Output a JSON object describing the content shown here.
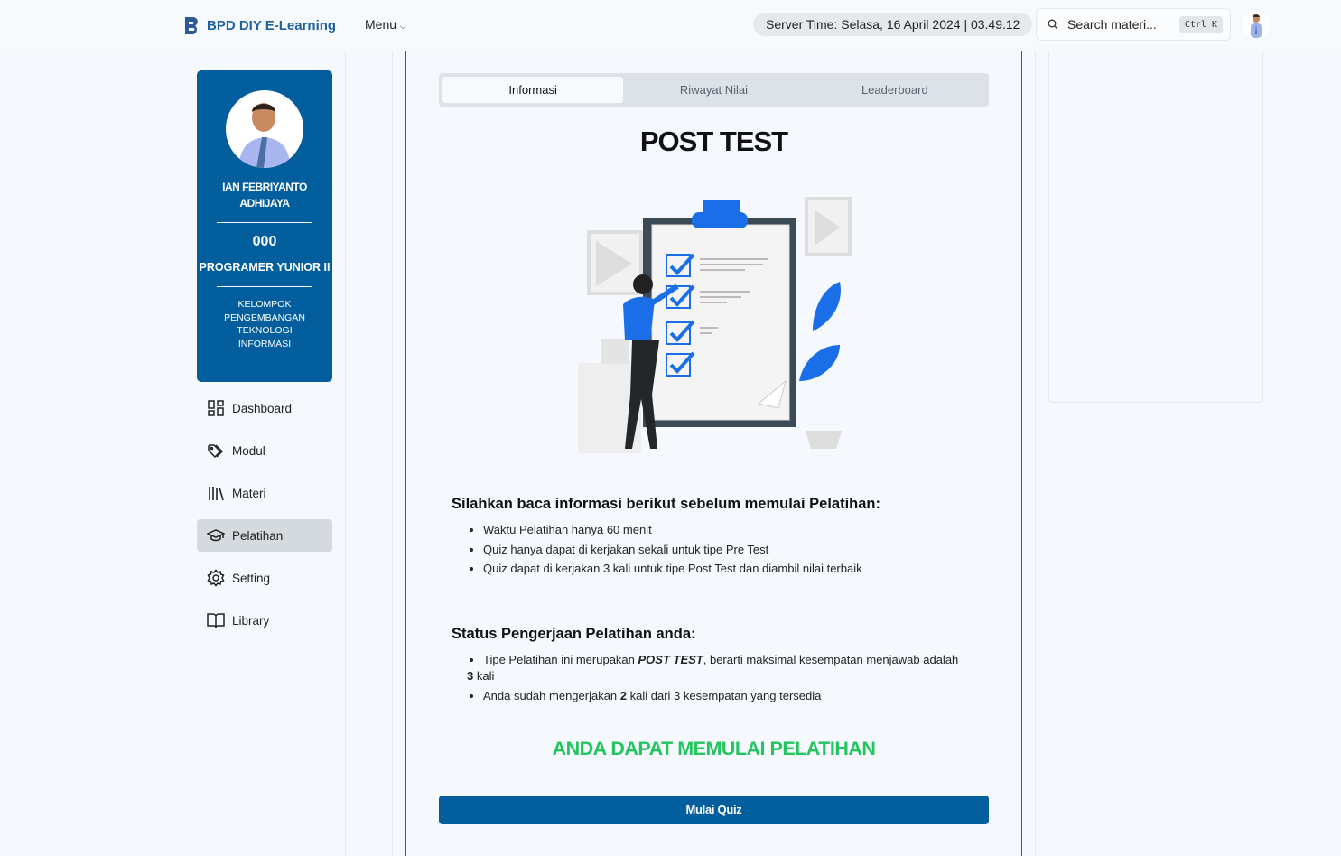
{
  "header": {
    "brand": "BPD DIY E-Learning",
    "menu_label": "Menu",
    "server_time": "Server Time: Selasa, 16 April 2024 | 03.49.12",
    "search_placeholder": "Search materi...",
    "shortcut": "Ctrl K"
  },
  "profile": {
    "name": "IAN FEBRIYANTO ADHIJAYA",
    "number": "000",
    "role": "PROGRAMER YUNIOR II",
    "group": "KELOMPOK PENGEMBANGAN TEKNOLOGI INFORMASI"
  },
  "sidebar": {
    "items": [
      {
        "label": "Dashboard",
        "icon": "dashboard-icon"
      },
      {
        "label": "Modul",
        "icon": "tags-icon"
      },
      {
        "label": "Materi",
        "icon": "library-icon"
      },
      {
        "label": "Pelatihan",
        "icon": "graduation-cap-icon",
        "active": true
      },
      {
        "label": "Setting",
        "icon": "gear-icon"
      },
      {
        "label": "Library",
        "icon": "book-open-icon"
      }
    ]
  },
  "main": {
    "tabs": [
      {
        "label": "Informasi",
        "active": true
      },
      {
        "label": "Riwayat Nilai"
      },
      {
        "label": "Leaderboard"
      }
    ],
    "title": "POST TEST",
    "info_heading": "Silahkan baca informasi berikut sebelum memulai Pelatihan:",
    "info_items": [
      "Waktu Pelatihan hanya 60 menit",
      "Quiz hanya dapat di kerjakan sekali untuk tipe Pre Test",
      "Quiz dapat di kerjakan 3 kali untuk tipe Post Test dan diambil nilai terbaik"
    ],
    "status_heading": "Status Pengerjaan Pelatihan anda:",
    "status_1": {
      "before": "Tipe Pelatihan ini merupakan ",
      "type": "POST TEST",
      "after": ", berarti maksimal kesempatan menjawab adalah ",
      "max": "3",
      "tail": " kali"
    },
    "status_2": {
      "before": "Anda sudah mengerjakan ",
      "done": "2",
      "after": " kali dari 3 kesempatan yang tersedia"
    },
    "ready_text": "ANDA DAPAT MEMULAI PELATIHAN",
    "start_button": "Mulai Quiz"
  },
  "colors": {
    "primary": "#035e9e",
    "success": "#22c55e",
    "brand_text": "#1f62a0"
  }
}
